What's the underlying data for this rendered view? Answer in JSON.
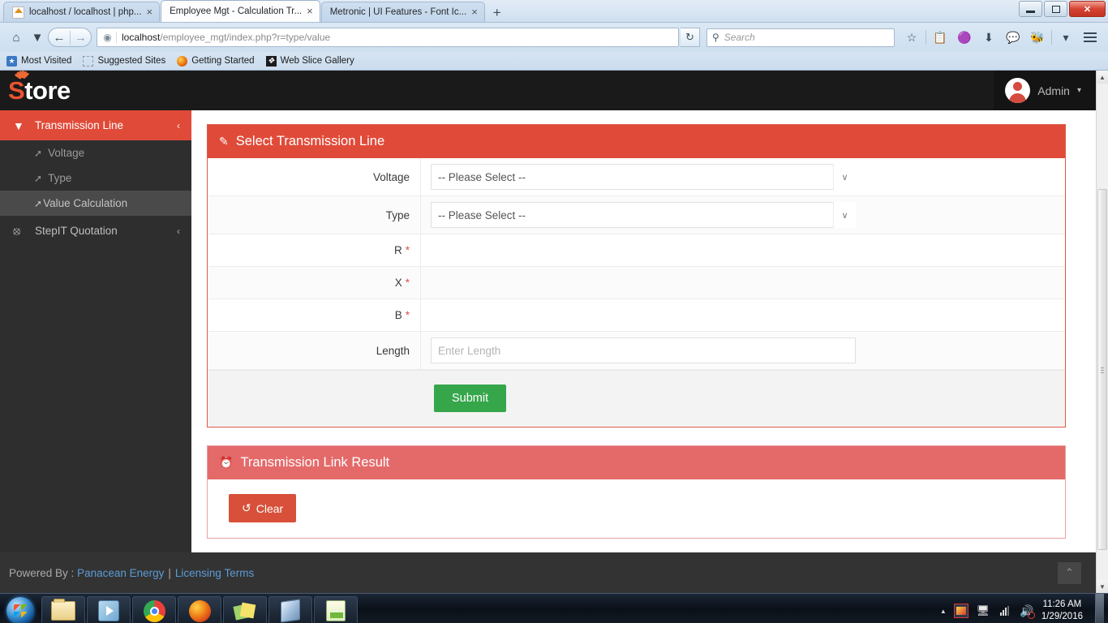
{
  "browser": {
    "tabs": [
      {
        "title": "localhost / localhost | php...",
        "favicon": "phpmyadmin-icon",
        "active": false
      },
      {
        "title": "Employee Mgt - Calculation Tr...",
        "favicon": "page-icon",
        "active": true
      },
      {
        "title": "Metronic | UI Features - Font Ic...",
        "favicon": "page-icon",
        "active": false
      }
    ],
    "new_tab_label": "+",
    "close_label": "×",
    "window_controls": {
      "minimize": "minimize-icon",
      "maximize": "maximize-icon",
      "close": "✕"
    },
    "nav": {
      "home_icon": "home-icon",
      "sync_icon": "sync-icon",
      "back_icon": "←",
      "forward_icon": "→",
      "reload_icon": "↻",
      "globe_icon": "⊕"
    },
    "url": {
      "host": "localhost",
      "path": "/employee_mgt/index.php?r=type/value"
    },
    "search": {
      "placeholder": "Search",
      "icon": "search-icon"
    },
    "toolbar_icons": [
      "bookmark-star-icon",
      "reading-list-icon",
      "pocket-icon",
      "downloads-icon",
      "chat-icon",
      "addon-icon",
      "overflow-caret-icon",
      "menu-icon"
    ],
    "bookmarks": [
      {
        "label": "Most Visited",
        "icon": "most-visited-icon"
      },
      {
        "label": "Suggested Sites",
        "icon": "suggested-sites-icon"
      },
      {
        "label": "Getting Started",
        "icon": "firefox-icon"
      },
      {
        "label": "Web Slice Gallery",
        "icon": "web-slice-icon"
      }
    ]
  },
  "app": {
    "logo": {
      "first": "S",
      "rest": "tore"
    },
    "user": {
      "name": "Admin",
      "caret": "▾",
      "avatar": "user-avatar"
    },
    "sidebar": {
      "items": [
        {
          "label": "Transmission Line",
          "icon": "filter-icon",
          "chevron": "‹",
          "active": true,
          "children": [
            {
              "label": "Voltage",
              "icon": "arrow-share-icon",
              "selected": false
            },
            {
              "label": "Type",
              "icon": "arrow-share-icon",
              "selected": false
            },
            {
              "label": "Value Calculation",
              "icon": "arrow-share-icon",
              "selected": true
            }
          ]
        },
        {
          "label": "StepIT Quotation",
          "icon": "cube-icon",
          "chevron": "‹",
          "active": false,
          "children": []
        }
      ]
    },
    "panels": {
      "select_line": {
        "title": "Select Transmission Line",
        "icon": "edit-pencil-square-icon",
        "fields": [
          {
            "label": "Voltage",
            "type": "select",
            "value": "-- Please Select --",
            "required": false
          },
          {
            "label": "Type",
            "type": "select",
            "value": "-- Please Select --",
            "required": false
          },
          {
            "label": "R",
            "type": "static",
            "value": "",
            "required": true
          },
          {
            "label": "X",
            "type": "static",
            "value": "",
            "required": true
          },
          {
            "label": "B",
            "type": "static",
            "value": "",
            "required": true
          },
          {
            "label": "Length",
            "type": "text",
            "value": "",
            "placeholder": "Enter Length",
            "required": false
          }
        ],
        "required_marker": "*",
        "submit_label": "Submit",
        "select_caret": "∨"
      },
      "result": {
        "title": "Transmission Link Result",
        "icon": "clock-back-icon",
        "clear_label": "Clear",
        "clear_icon": "↺"
      }
    },
    "footer": {
      "prefix": "Powered By :",
      "company": "Panacean Energy",
      "separator": "|",
      "terms": "Licensing Terms",
      "to_top_icon": "⌃"
    }
  },
  "colors": {
    "brand_red": "#e04b39",
    "panel_light_red": "#e46a6a",
    "submit_green": "#36a64b",
    "clear_red": "#d8503a",
    "sidebar_bg": "#2e2e2e",
    "header_bg": "#1a1a1a",
    "footer_bg": "#333333",
    "link_blue": "#5b9bd5",
    "required_red": "#d9534f"
  },
  "taskbar": {
    "start_label": "start-orb",
    "items": [
      "windows-explorer-icon",
      "windows-media-player-icon",
      "google-chrome-icon",
      "mozilla-firefox-icon",
      "sticky-notes-icon",
      "virtualbox-icon",
      "notepad-plus-plus-icon"
    ],
    "tray": {
      "expand_icon": "▲",
      "icons": [
        "graphics-driver-icon",
        "safely-remove-hardware-icon",
        "network-icon",
        "volume-muted-icon"
      ],
      "time": "11:26 AM",
      "date": "1/29/2016"
    }
  }
}
